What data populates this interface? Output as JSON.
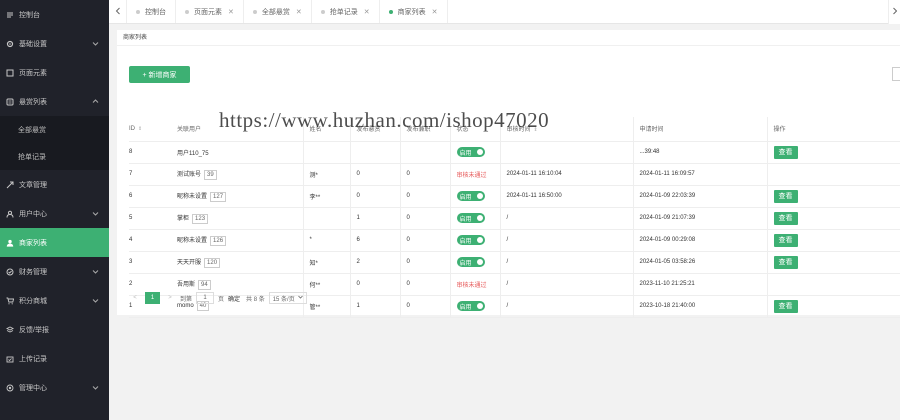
{
  "sidebar": {
    "items": [
      {
        "label": "控制台",
        "icon": "dashboard-icon"
      },
      {
        "label": "基础设置",
        "icon": "gear-icon",
        "arrow": "chevron-down-icon"
      },
      {
        "label": "页面元素",
        "icon": "page-icon"
      },
      {
        "label": "悬赏列表",
        "icon": "list-icon",
        "arrow": "chevron-up-icon"
      },
      {
        "label": "文章管理",
        "icon": "article-icon"
      },
      {
        "label": "用户中心",
        "icon": "user-icon",
        "arrow": "chevron-down-icon"
      },
      {
        "label": "商家列表",
        "icon": "merchant-icon"
      },
      {
        "label": "财务管理",
        "icon": "finance-icon",
        "arrow": "chevron-down-icon"
      },
      {
        "label": "积分商城",
        "icon": "cart-icon",
        "arrow": "chevron-down-icon"
      },
      {
        "label": "反馈/举报",
        "icon": "feedback-icon"
      },
      {
        "label": "上传记录",
        "icon": "upload-icon"
      },
      {
        "label": "管理中心",
        "icon": "admin-icon",
        "arrow": "chevron-down-icon"
      }
    ],
    "sub_items": [
      {
        "label": "全部悬赏"
      },
      {
        "label": "抢单记录"
      }
    ],
    "active": "商家列表"
  },
  "tabs": [
    {
      "label": "控制台"
    },
    {
      "label": "页面元素"
    },
    {
      "label": "全部悬赏"
    },
    {
      "label": "抢单记录"
    },
    {
      "label": "商家列表",
      "active": true
    }
  ],
  "page": {
    "title": "商家列表",
    "add_button": "+ 新增商家"
  },
  "table": {
    "columns": [
      "ID",
      "关联用户",
      "姓名",
      "发布悬赏",
      "发布兼职",
      "状态",
      "审核时间",
      "申请时间",
      "操作"
    ],
    "rows": [
      {
        "id": "8",
        "user": "用户110_75",
        "tag": "",
        "name": "",
        "bounty": "",
        "parttime": "",
        "status": "启用",
        "review_time": "",
        "apply_time": "...39:48",
        "action": "查看"
      },
      {
        "id": "7",
        "user": "测试账号",
        "tag": "39",
        "name": "测*",
        "bounty": "0",
        "parttime": "0",
        "status": "审核未通过",
        "review_time": "2024-01-11 16:10:04",
        "apply_time": "2024-01-11 16:09:57",
        "action": ""
      },
      {
        "id": "6",
        "user": "昵称未设置",
        "tag": "127",
        "name": "李**",
        "bounty": "0",
        "parttime": "0",
        "status": "启用",
        "review_time": "2024-01-11 16:50:00",
        "apply_time": "2024-01-09 22:03:39",
        "action": "查看"
      },
      {
        "id": "5",
        "user": "掌柜",
        "tag": "123",
        "name": "",
        "bounty": "1",
        "parttime": "0",
        "status": "启用",
        "review_time": "/",
        "apply_time": "2024-01-09 21:07:39",
        "action": "查看"
      },
      {
        "id": "4",
        "user": "昵称未设置",
        "tag": "126",
        "name": "*",
        "bounty": "6",
        "parttime": "0",
        "status": "启用",
        "review_time": "/",
        "apply_time": "2024-01-09 00:29:08",
        "action": "查看"
      },
      {
        "id": "3",
        "user": "天天开服",
        "tag": "120",
        "name": "知*",
        "bounty": "2",
        "parttime": "0",
        "status": "启用",
        "review_time": "/",
        "apply_time": "2024-01-05 03:58:26",
        "action": "查看"
      },
      {
        "id": "2",
        "user": "吾用斯",
        "tag": "94",
        "name": "何**",
        "bounty": "0",
        "parttime": "0",
        "status": "审核未通过",
        "review_time": "/",
        "apply_time": "2023-11-10 21:25:21",
        "action": ""
      },
      {
        "id": "1",
        "user": "momo",
        "tag": "40",
        "name": "管**",
        "bounty": "1",
        "parttime": "0",
        "status": "启用",
        "review_time": "/",
        "apply_time": "2023-10-18 21:40:00",
        "action": "查看"
      }
    ]
  },
  "pager": {
    "prev": "<",
    "current": "1",
    "next": ">",
    "goto_label": "到第",
    "goto_value": "1",
    "page_unit": "页",
    "confirm": "确定",
    "total": "共 8 条",
    "page_size": "15 条/页"
  },
  "watermark": "https://www.huzhan.com/ishop47020",
  "colors": {
    "accent": "#3db073",
    "sidebar": "#20222a",
    "fail": "#e65555"
  }
}
